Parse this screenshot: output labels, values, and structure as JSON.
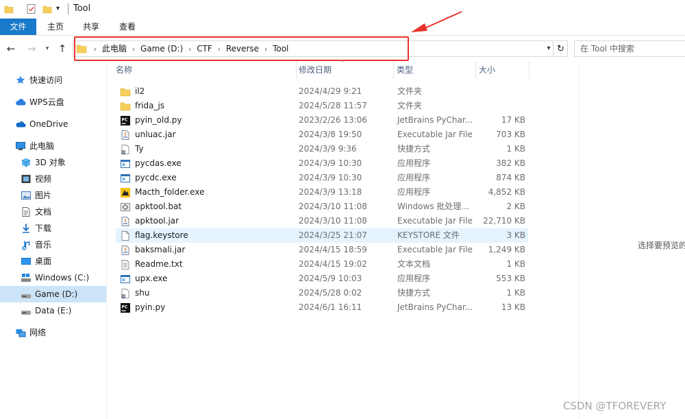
{
  "window": {
    "title": "Tool"
  },
  "ribbon": {
    "tabs": [
      "文件",
      "主页",
      "共享",
      "查看"
    ]
  },
  "address": {
    "breadcrumb": [
      "此电脑",
      "Game (D:)",
      "CTF",
      "Reverse",
      "Tool"
    ]
  },
  "search": {
    "placeholder": "在 Tool 中搜索"
  },
  "sidebar": {
    "items": [
      {
        "label": "快速访问",
        "icon": "star-icon"
      },
      {
        "label": "WPS云盘",
        "icon": "cloud-icon"
      },
      {
        "label": "OneDrive",
        "icon": "onedrive-icon"
      },
      {
        "label": "此电脑",
        "icon": "computer-icon"
      },
      {
        "label": "3D 对象",
        "icon": "cube-icon"
      },
      {
        "label": "视频",
        "icon": "video-icon"
      },
      {
        "label": "图片",
        "icon": "picture-icon"
      },
      {
        "label": "文档",
        "icon": "document-icon"
      },
      {
        "label": "下载",
        "icon": "download-icon"
      },
      {
        "label": "音乐",
        "icon": "music-icon"
      },
      {
        "label": "桌面",
        "icon": "desktop-icon"
      },
      {
        "label": "Windows (C:)",
        "icon": "windows-drive-icon"
      },
      {
        "label": "Game (D:)",
        "icon": "drive-icon"
      },
      {
        "label": "Data (E:)",
        "icon": "drive-icon"
      },
      {
        "label": "网络",
        "icon": "network-icon"
      }
    ]
  },
  "columns": {
    "name": "名称",
    "date": "修改日期",
    "type": "类型",
    "size": "大小"
  },
  "files": [
    {
      "name": "il2",
      "date": "2024/4/29 9:21",
      "type": "文件夹",
      "size": "",
      "icon": "folder-icon"
    },
    {
      "name": "frida_js",
      "date": "2024/5/28 11:57",
      "type": "文件夹",
      "size": "",
      "icon": "folder-icon"
    },
    {
      "name": "pyin_old.py",
      "date": "2023/2/26 13:06",
      "type": "JetBrains PyChar...",
      "size": "17 KB",
      "icon": "pycharm-icon"
    },
    {
      "name": "unluac.jar",
      "date": "2024/3/8 19:50",
      "type": "Executable Jar File",
      "size": "703 KB",
      "icon": "jar-icon"
    },
    {
      "name": "Ty",
      "date": "2024/3/9 9:36",
      "type": "快捷方式",
      "size": "1 KB",
      "icon": "shortcut-icon"
    },
    {
      "name": "pycdas.exe",
      "date": "2024/3/9 10:30",
      "type": "应用程序",
      "size": "382 KB",
      "icon": "exe-icon"
    },
    {
      "name": "pycdc.exe",
      "date": "2024/3/9 10:30",
      "type": "应用程序",
      "size": "874 KB",
      "icon": "exe-icon"
    },
    {
      "name": "Macth_folder.exe",
      "date": "2024/3/9 13:18",
      "type": "应用程序",
      "size": "4,852 KB",
      "icon": "app-icon"
    },
    {
      "name": "apktool.bat",
      "date": "2024/3/10 11:08",
      "type": "Windows 批处理...",
      "size": "2 KB",
      "icon": "bat-icon"
    },
    {
      "name": "apktool.jar",
      "date": "2024/3/10 11:08",
      "type": "Executable Jar File",
      "size": "22,710 KB",
      "icon": "jar-icon"
    },
    {
      "name": "flag.keystore",
      "date": "2024/3/25 21:07",
      "type": "KEYSTORE 文件",
      "size": "3 KB",
      "icon": "file-icon"
    },
    {
      "name": "baksmali.jar",
      "date": "2024/4/15 18:59",
      "type": "Executable Jar File",
      "size": "1,249 KB",
      "icon": "jar-icon"
    },
    {
      "name": "Readme.txt",
      "date": "2024/4/15 19:02",
      "type": "文本文档",
      "size": "1 KB",
      "icon": "text-file-icon"
    },
    {
      "name": "upx.exe",
      "date": "2024/5/9 10:03",
      "type": "应用程序",
      "size": "553 KB",
      "icon": "exe-icon"
    },
    {
      "name": "shu",
      "date": "2024/5/28 0:02",
      "type": "快捷方式",
      "size": "1 KB",
      "icon": "shortcut-icon"
    },
    {
      "name": "pyin.py",
      "date": "2024/6/1 16:11",
      "type": "JetBrains PyChar...",
      "size": "13 KB",
      "icon": "pycharm-icon"
    }
  ],
  "preview": {
    "text": "选择要预览的"
  },
  "watermark": "CSDN @TFOREVERY",
  "colors": {
    "accent": "#1979ca",
    "selection": "#cce4f7",
    "hover": "#e5f3ff",
    "annotation": "#e8322c"
  }
}
